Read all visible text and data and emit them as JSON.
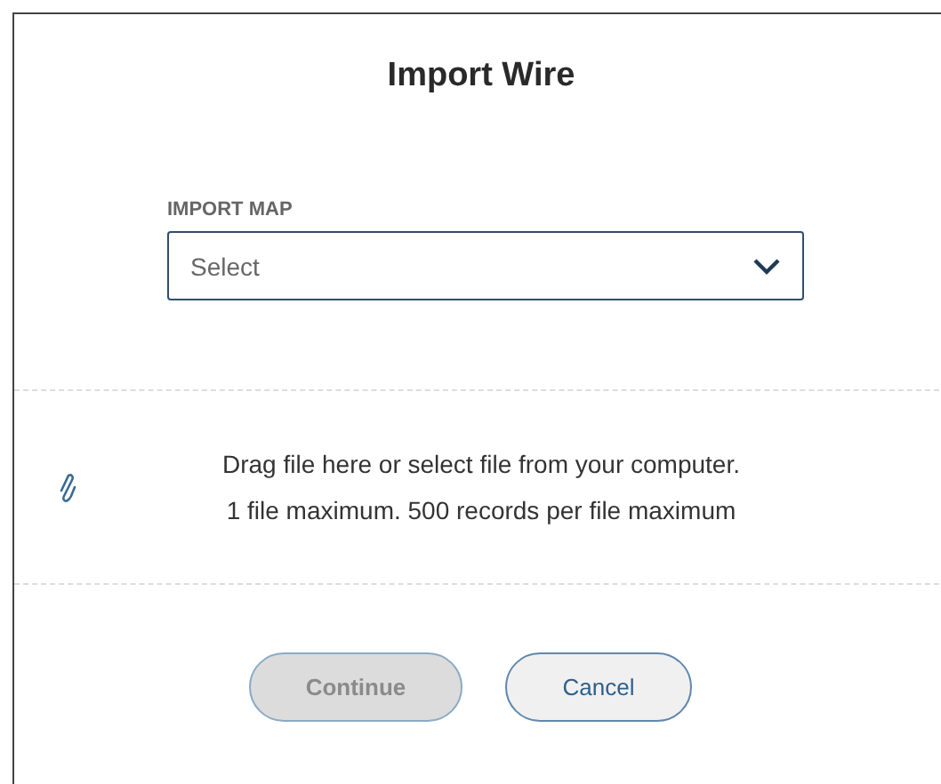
{
  "dialog": {
    "title": "Import Wire"
  },
  "import_map": {
    "label": "IMPORT MAP",
    "placeholder": "Select"
  },
  "dropzone": {
    "lines": [
      "Drag file here or select file from your computer.",
      "1 file maximum. 500 records per file maximum"
    ]
  },
  "buttons": [
    {
      "label": "Continue",
      "disabled": true
    },
    {
      "label": "Cancel",
      "disabled": false
    }
  ]
}
